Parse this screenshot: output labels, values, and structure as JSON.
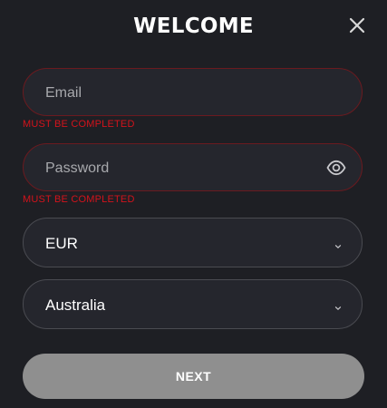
{
  "modal": {
    "title": "WELCOME",
    "close_icon": "close-icon"
  },
  "form": {
    "email": {
      "placeholder": "Email",
      "value": "",
      "error": "MUST BE COMPLETED"
    },
    "password": {
      "placeholder": "Password",
      "value": "",
      "error": "MUST BE COMPLETED",
      "toggle_icon": "eye-icon"
    },
    "currency": {
      "selected": "EUR",
      "icon": "chevron-down-icon"
    },
    "country": {
      "selected": "Australia",
      "icon": "chevron-down-icon"
    },
    "next_label": "NEXT"
  },
  "colors": {
    "background": "#1e1f24",
    "field_background": "#25262d",
    "error_border": "#6b1a1f",
    "error_text": "#d3131b",
    "button_disabled": "#8f8f8f"
  }
}
